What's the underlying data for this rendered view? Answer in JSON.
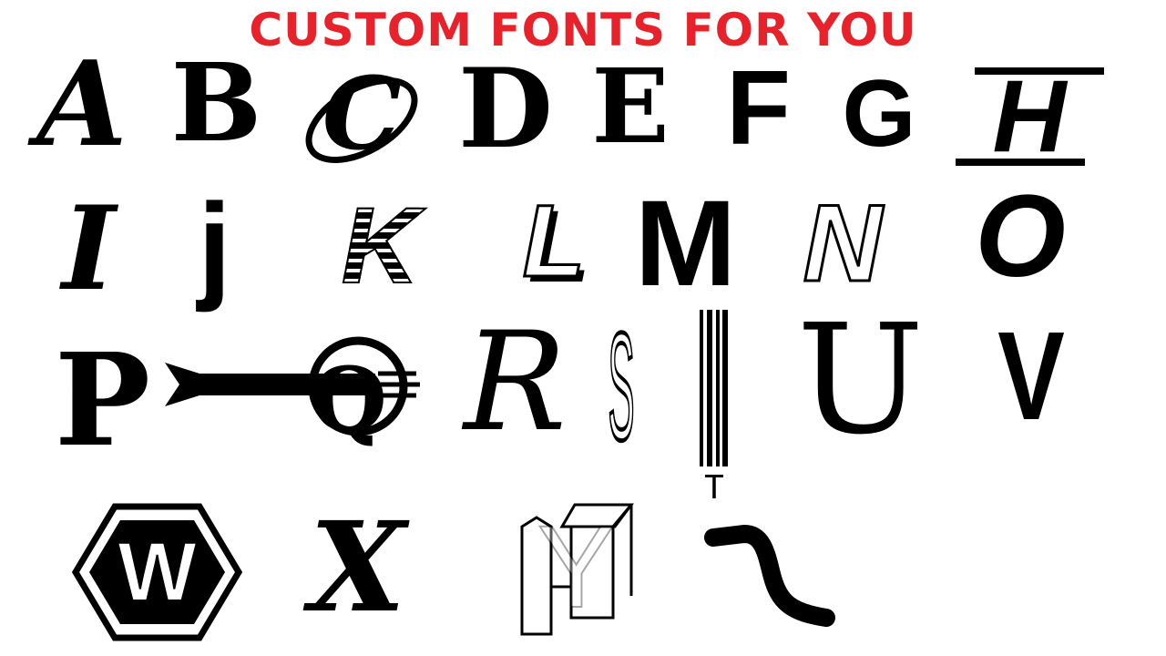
{
  "title": "CUSTOM FONTS FOR YOU",
  "title_color": "#e8222b",
  "letters": {
    "a": "A",
    "b": "B",
    "c": "C",
    "d": "D",
    "e": "E",
    "f": "F",
    "g": "G",
    "h": "H",
    "i": "I",
    "j": "j",
    "k": "K",
    "l": "L",
    "m": "M",
    "n": "N",
    "o": "O",
    "p": "P",
    "q": "Q",
    "r": "R",
    "s": "S",
    "t": "T",
    "u": "U",
    "v": "V",
    "w": "W",
    "x": "X",
    "y": "Y",
    "z": "Z"
  }
}
